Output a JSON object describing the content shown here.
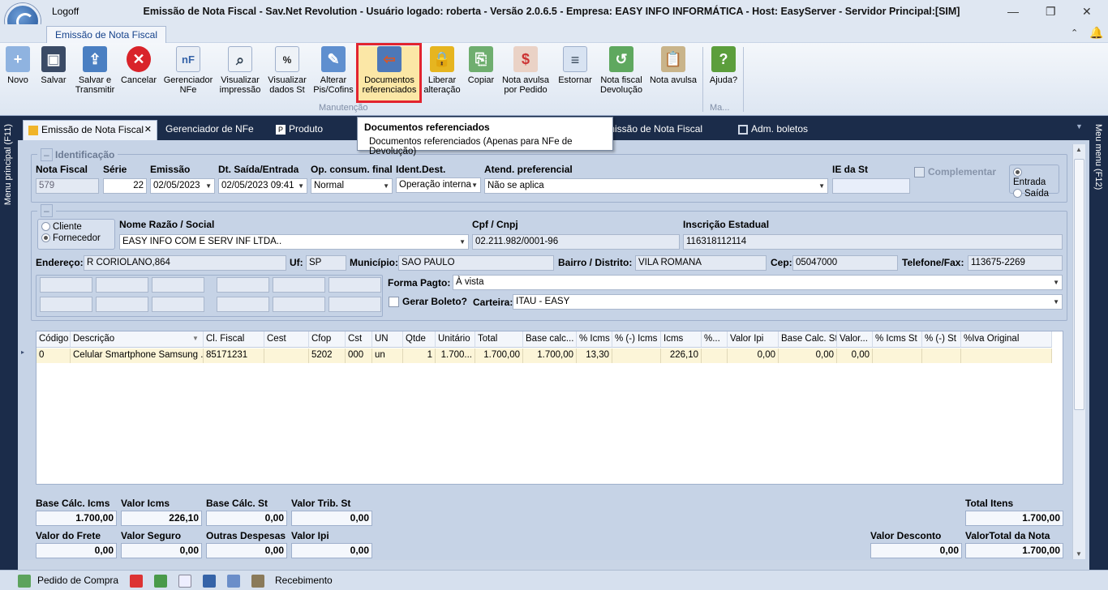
{
  "window": {
    "title": "Emissão de Nota Fiscal - Sav.Net Revolution - Usuário logado: roberta - Versão 2.0.6.5 - Empresa: EASY INFO INFORMÁTICA - Host: EasyServer - Servidor Principal:[SIM]",
    "logoff": "Logoff",
    "min": "—",
    "max": "❐",
    "close": "✕"
  },
  "ribbon": {
    "tab": "Emissão de Nota Fiscal",
    "group_label": "Manutenção",
    "group2_label": "Ma...",
    "buttons": [
      "Novo",
      "Salvar",
      "Salvar e\nTransmitir",
      "Cancelar",
      "Gerenciador\nNFe",
      "Visualizar\nimpressão",
      "Visualizar\ndados St",
      "Alterar\nPis/Cofins",
      "Documentos\nreferenciados",
      "Liberar\nalteração",
      "Copiar",
      "Nota avulsa\npor Pedido",
      "Estornar",
      "Nota fiscal\nDevolução",
      "Nota avulsa",
      "Ajuda?"
    ]
  },
  "side": {
    "left": "Menu principal (F11)",
    "right": "Meu menu (F12)"
  },
  "tabs": [
    "Emissão de Nota Fiscal",
    "Gerenciador de NFe",
    "Produto",
    "Emissão de Nota Fiscal",
    "Adm. boletos"
  ],
  "tab_close": "✕",
  "tooltip": {
    "title": "Documentos referenciados",
    "desc": "Documentos referenciados (Apenas para NFe de Devolução)"
  },
  "ident": {
    "legend": "Identificação",
    "nota_label": "Nota Fiscal",
    "nota": "579",
    "serie_label": "Série",
    "serie": "22",
    "emissao_label": "Emissão",
    "emissao": "02/05/2023",
    "saida_label": "Dt. Saída/Entrada",
    "saida": "02/05/2023 09:41",
    "op_label": "Op. consum. final",
    "op": "Normal",
    "dest_label": "Ident.Dest.",
    "dest": "Operação interna",
    "atend_label": "Atend. preferencial",
    "atend": "Não se aplica",
    "ie_label": "IE da St",
    "ie": "",
    "comp_label": "Complementar",
    "entrada": "Entrada",
    "saida_r": "Saída"
  },
  "party": {
    "cliente": "Cliente",
    "fornecedor": "Fornecedor",
    "nome_label": "Nome Razão / Social",
    "nome": "EASY INFO COM E SERV INF LTDA..",
    "cpf_label": "Cpf / Cnpj",
    "cpf": "02.211.982/0001-96",
    "ie_label": "Inscrição Estadual",
    "ie": "116318112114",
    "end_label": "Endereço:",
    "end": "R CORIOLANO,864",
    "uf_label": "Uf:",
    "uf": "SP",
    "mun_label": "Município:",
    "mun": "SAO PAULO",
    "bairro_label": "Bairro / Distrito:",
    "bairro": "VILA ROMANA",
    "cep_label": "Cep:",
    "cep": "05047000",
    "tel_label": "Telefone/Fax:",
    "tel": "113675-2269",
    "forma_label": "Forma Pagto:",
    "forma": "À vista",
    "boleto_label": "Gerar Boleto?",
    "carteira_label": "Carteira:",
    "carteira": "ITAU - EASY"
  },
  "grid": {
    "headers": [
      "Código",
      "Descrição",
      "Cl. Fiscal",
      "Cest",
      "Cfop",
      "Cst",
      "UN",
      "Qtde",
      "Unitário",
      "Total",
      "Base calc...",
      "% Icms",
      "% (-) Icms",
      "Icms",
      "%...",
      "Valor Ipi",
      "Base Calc. St",
      "Valor...",
      "% Icms St",
      "% (-) St",
      "%Iva Original"
    ],
    "row": [
      "0",
      "Celular Smartphone Samsung ...",
      "85171231",
      "",
      "5202",
      "000",
      "un",
      "1",
      "1.700...",
      "1.700,00",
      "1.700,00",
      "13,30",
      "",
      "226,10",
      "",
      "0,00",
      "0,00",
      "0,00",
      "",
      "",
      ""
    ]
  },
  "totals": {
    "base_icms_label": "Base Cálc. Icms",
    "base_icms": "1.700,00",
    "valor_icms_label": "Valor Icms",
    "valor_icms": "226,10",
    "base_st_label": "Base Cálc. St",
    "base_st": "0,00",
    "trib_st_label": "Valor Trib. St",
    "trib_st": "0,00",
    "total_itens_label": "Total Itens",
    "total_itens": "1.700,00",
    "frete_label": "Valor do Frete",
    "frete": "0,00",
    "seguro_label": "Valor Seguro",
    "seguro": "0,00",
    "outras_label": "Outras Despesas",
    "outras": "0,00",
    "ipi_label": "Valor Ipi",
    "ipi": "0,00",
    "desconto_label": "Valor Desconto",
    "desconto": "0,00",
    "total_nota_label": "ValorTotal da Nota",
    "total_nota": "1.700,00"
  },
  "status": {
    "pedido": "Pedido de Compra",
    "recebimento": "Recebimento"
  }
}
